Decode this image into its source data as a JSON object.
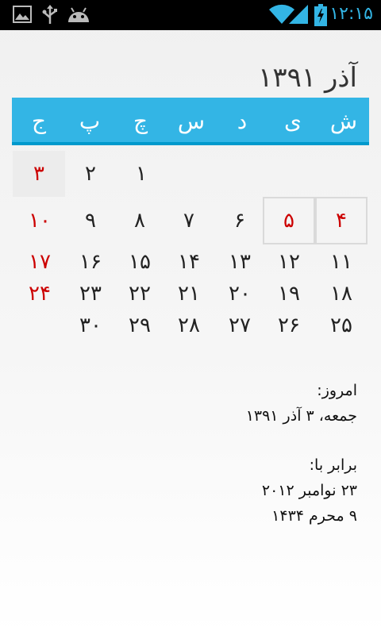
{
  "status_bar": {
    "time": "۱۲:۱۵",
    "icons": [
      "image-icon",
      "usb-icon",
      "android-icon",
      "wifi-icon",
      "signal-icon",
      "battery-charging-icon"
    ]
  },
  "calendar": {
    "title": "آذر ۱۳۹۱",
    "weekdays": [
      "ش",
      "ی",
      "د",
      "س",
      "چ",
      "پ",
      "ج"
    ],
    "weeks": [
      [
        "",
        "",
        "",
        "",
        "۱",
        "۲",
        "۳"
      ],
      [
        "۴",
        "۵",
        "۶",
        "۷",
        "۸",
        "۹",
        "۱۰"
      ],
      [
        "۱۱",
        "۱۲",
        "۱۳",
        "۱۴",
        "۱۵",
        "۱۶",
        "۱۷"
      ],
      [
        "۱۸",
        "۱۹",
        "۲۰",
        "۲۱",
        "۲۲",
        "۲۳",
        "۲۴"
      ],
      [
        "۲۵",
        "۲۶",
        "۲۷",
        "۲۸",
        "۲۹",
        "۳۰",
        ""
      ]
    ],
    "holiday_color": "#cc0000",
    "header_color": "#33b5e5"
  },
  "info": {
    "today_label": "امروز:",
    "today_value": "جمعه، ۳ آذر ۱۳۹۱",
    "equals_label": "برابر با:",
    "gregorian": "۲۳ نوامبر ۲۰۱۲",
    "hijri": "۹ محرم ۱۴۳۴"
  }
}
